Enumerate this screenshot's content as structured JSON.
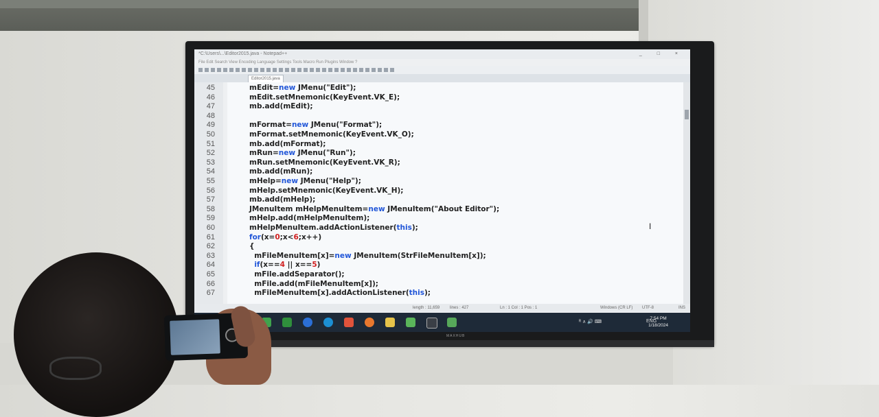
{
  "window": {
    "title": "*C:\\Users\\...\\Editor2015.java - Notepad++",
    "controls": "_ □ ×"
  },
  "menubar": {
    "items": [
      "File",
      "Edit",
      "Search",
      "View",
      "Encoding",
      "Language",
      "Settings",
      "Tools",
      "Macro",
      "Run",
      "Plugins",
      "Window",
      "?"
    ]
  },
  "tab": {
    "label": "Editor2015.java"
  },
  "code_lines": [
    {
      "n": "45",
      "parts": [
        [
          "t",
          "mEdit="
        ],
        [
          "k",
          "new"
        ],
        [
          "t",
          " JMenu(\"Edit\");"
        ]
      ]
    },
    {
      "n": "46",
      "parts": [
        [
          "t",
          "mEdit.setMnemonic(KeyEvent.VK_E);"
        ]
      ]
    },
    {
      "n": "47",
      "parts": [
        [
          "t",
          "mb.add(mEdit);"
        ]
      ]
    },
    {
      "n": "48",
      "parts": []
    },
    {
      "n": "49",
      "parts": [
        [
          "t",
          "mFormat="
        ],
        [
          "k",
          "new"
        ],
        [
          "t",
          " JMenu(\"Format\");"
        ]
      ]
    },
    {
      "n": "50",
      "parts": [
        [
          "t",
          "mFormat.setMnemonic(KeyEvent.VK_O);"
        ]
      ]
    },
    {
      "n": "51",
      "parts": [
        [
          "t",
          "mb.add(mFormat);"
        ]
      ]
    },
    {
      "n": "52",
      "parts": [
        [
          "t",
          "mRun="
        ],
        [
          "k",
          "new"
        ],
        [
          "t",
          " JMenu(\"Run\");"
        ]
      ]
    },
    {
      "n": "53",
      "parts": [
        [
          "t",
          "mRun.setMnemonic(KeyEvent.VK_R);"
        ]
      ]
    },
    {
      "n": "54",
      "parts": [
        [
          "t",
          "mb.add(mRun);"
        ]
      ]
    },
    {
      "n": "55",
      "parts": [
        [
          "t",
          "mHelp="
        ],
        [
          "k",
          "new"
        ],
        [
          "t",
          " JMenu(\"Help\");"
        ]
      ]
    },
    {
      "n": "56",
      "parts": [
        [
          "t",
          "mHelp.setMnemonic(KeyEvent.VK_H);"
        ]
      ]
    },
    {
      "n": "57",
      "parts": [
        [
          "t",
          "mb.add(mHelp);"
        ]
      ]
    },
    {
      "n": "58",
      "parts": [
        [
          "t",
          "JMenuItem mHelpMenuItem="
        ],
        [
          "k",
          "new"
        ],
        [
          "t",
          " JMenuItem(\"About Editor\");"
        ]
      ]
    },
    {
      "n": "59",
      "parts": [
        [
          "t",
          "mHelp.add(mHelpMenuItem);"
        ]
      ]
    },
    {
      "n": "60",
      "parts": [
        [
          "t",
          "mHelpMenuItem.addActionListener("
        ],
        [
          "k",
          "this"
        ],
        [
          "t",
          ");"
        ]
      ]
    },
    {
      "n": "61",
      "parts": [
        [
          "k",
          "for"
        ],
        [
          "t",
          "(x="
        ],
        [
          "d",
          "0"
        ],
        [
          "t",
          ";x<"
        ],
        [
          "d",
          "6"
        ],
        [
          "t",
          ";x++)"
        ]
      ]
    },
    {
      "n": "62",
      "parts": [
        [
          "t",
          "{"
        ]
      ]
    },
    {
      "n": "63",
      "parts": [
        [
          "t",
          "  mFileMenuItem[x]="
        ],
        [
          "k",
          "new"
        ],
        [
          "t",
          " JMenuItem(StrFileMenuItem[x]);"
        ]
      ]
    },
    {
      "n": "64",
      "parts": [
        [
          "t",
          "  "
        ],
        [
          "k",
          "if"
        ],
        [
          "t",
          "(x=="
        ],
        [
          "d",
          "4"
        ],
        [
          "t",
          " || x=="
        ],
        [
          "d",
          "5"
        ],
        [
          "t",
          ")"
        ]
      ]
    },
    {
      "n": "65",
      "parts": [
        [
          "t",
          "  mFile.addSeparator();"
        ]
      ]
    },
    {
      "n": "66",
      "parts": [
        [
          "t",
          "  mFile.add(mFileMenuItem[x]);"
        ]
      ]
    },
    {
      "n": "67",
      "parts": [
        [
          "t",
          "  mFileMenuItem[x].addActionListener("
        ],
        [
          "k",
          "this"
        ],
        [
          "t",
          ");"
        ]
      ]
    }
  ],
  "statusbar": {
    "length": "length : 11,659",
    "lines": "lines : 427",
    "position": "Ln : 1    Col : 1    Pos : 1",
    "eol": "Windows (CR LF)",
    "encoding": "UTF-8",
    "mode": "INS"
  },
  "taskbar": {
    "lang": "ENG",
    "time": "7:54 PM",
    "date": "1/18/2024"
  },
  "tv_brand": "MAXHUB",
  "colors": {
    "keyword": "#2156d8",
    "number": "#d02020",
    "text": "#222222"
  }
}
